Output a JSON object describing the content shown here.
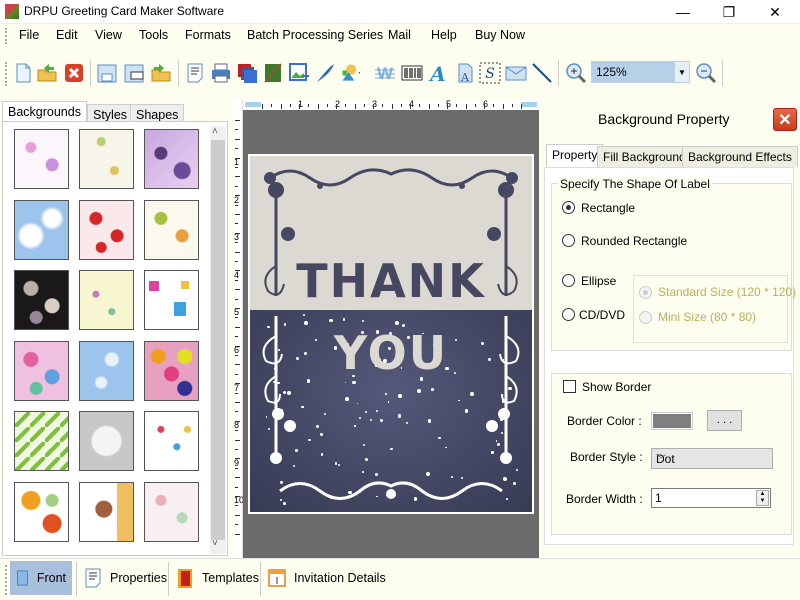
{
  "window": {
    "title": "DRPU Greeting Card Maker Software",
    "minimize_glyph": "—",
    "restore_glyph": "❐",
    "close_glyph": "✕"
  },
  "menu": [
    "File",
    "Edit",
    "View",
    "Tools",
    "Formats",
    "Batch Processing Series",
    "Mail",
    "Help",
    "Buy Now"
  ],
  "toolbar": {
    "icons": [
      "new-icon",
      "open-icon",
      "close-file-icon",
      "save-icon",
      "save-as-icon",
      "export-icon",
      "page-setup-icon",
      "print-icon",
      "copy-pages-icon",
      "background-image-icon",
      "insert-image-icon",
      "signature-pen-icon",
      "shapes-icon",
      "watermark-icon",
      "barcode-icon",
      "text-icon",
      "word-art-icon",
      "select-tool-icon",
      "mail-icon",
      "line-icon",
      "zoom-in-icon",
      "zoom-out-icon"
    ],
    "zoom_value": "125%"
  },
  "left_panel": {
    "tabs": [
      "Backgrounds",
      "Styles",
      "Shapes"
    ],
    "active_tab": "Backgrounds",
    "thumbnails": [
      "baby-doodles",
      "bird-doodles",
      "purple-flowers",
      "sky-clouds",
      "strawberries",
      "autumn-leaves",
      "dark-leaves",
      "pastel-flowers",
      "gift-boxes",
      "colorful-flowers",
      "snowflakes-blue",
      "flower-circles",
      "christmas-trees",
      "white-heart",
      "kids-party",
      "butterflies",
      "teddy-bear-card",
      "pastel-splatter"
    ]
  },
  "rulers": {
    "horizontal": [
      "1",
      "2",
      "3",
      "4",
      "5",
      "6"
    ],
    "vertical": [
      "1",
      "2",
      "3",
      "4",
      "5",
      "6",
      "7",
      "8",
      "9",
      "10"
    ]
  },
  "card": {
    "line1": "THANK",
    "line2": "YOU",
    "top_color": "#dcd9d3",
    "bottom_color": "#40435e"
  },
  "right_panel": {
    "title": "Background Property",
    "tabs": [
      "Property",
      "Fill Background",
      "Background Effects"
    ],
    "active_tab": "Property",
    "shape_group": {
      "legend": "Specify The Shape Of Label",
      "options": [
        "Rectangle",
        "Rounded Rectangle",
        "Ellipse",
        "CD/DVD"
      ],
      "selected": "Rectangle",
      "cd_sizes": [
        "Standard Size (120 * 120)",
        "Mini Size (80 * 80)"
      ],
      "cd_selected": "Standard Size (120 * 120)"
    },
    "border_group": {
      "show_border_label": "Show Border",
      "show_border_checked": false,
      "border_color_label": "Border Color :",
      "border_color": "#7f7f7f",
      "browse_label": ". . .",
      "border_style_label": "Border Style :",
      "border_style_value": "Dot",
      "border_width_label": "Border Width :",
      "border_width_value": "1"
    }
  },
  "bottom_bar": {
    "items": [
      "Front",
      "Properties",
      "Templates",
      "Invitation Details"
    ],
    "active": "Front"
  }
}
